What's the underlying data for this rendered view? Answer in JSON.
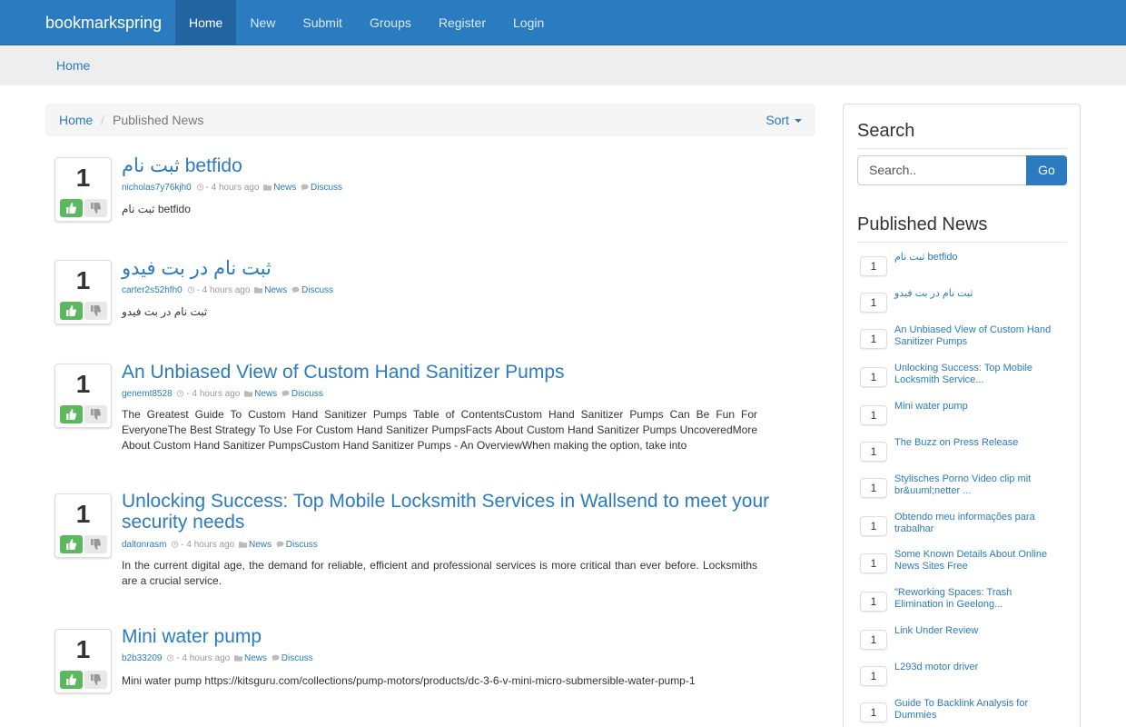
{
  "navbar": {
    "brand": "bookmarkspring",
    "items": [
      {
        "label": "Home",
        "active": true
      },
      {
        "label": "New"
      },
      {
        "label": "Submit"
      },
      {
        "label": "Groups"
      },
      {
        "label": "Register"
      },
      {
        "label": "Login"
      }
    ]
  },
  "jumbotron": {
    "label": "Home"
  },
  "breadcrumb": {
    "home": "Home",
    "current": "Published News",
    "sort_label": "Sort"
  },
  "posts": [
    {
      "votes": "1",
      "title": "ثبت نام betfido",
      "author": "nicholas7y76kjh0",
      "time": "- 4 hours ago",
      "category": "News",
      "discuss": "Discuss",
      "excerpt": "ثبت نام betfido"
    },
    {
      "votes": "1",
      "title": "ثبت نام در بت فیدو",
      "author": "carter2s52hfh0",
      "time": "- 4 hours ago",
      "category": "News",
      "discuss": "Discuss",
      "excerpt": "ثبت نام در بت فیدو"
    },
    {
      "votes": "1",
      "title": "An Unbiased View of Custom Hand Sanitizer Pumps",
      "author": "genemt8528",
      "time": "- 4 hours ago",
      "category": "News",
      "discuss": "Discuss",
      "excerpt": "The Greatest Guide To Custom Hand Sanitizer Pumps Table of ContentsCustom Hand Sanitizer Pumps Can Be Fun For EveryoneThe Best Strategy To Use For Custom Hand Sanitizer PumpsFacts About Custom Hand Sanitizer Pumps UncoveredMore About Custom Hand Sanitizer PumpsCustom Hand Sanitizer Pumps - An OverviewWhen making the option, take into"
    },
    {
      "votes": "1",
      "title": "Unlocking Success: Top Mobile Locksmith Services in Wallsend to meet your security needs",
      "author": "daltonrasm",
      "time": "- 4 hours ago",
      "category": "News",
      "discuss": "Discuss",
      "excerpt": "In the current digital age, the demand for reliable, efficient and professional services is more critical than ever before. Locksmiths are a crucial service."
    },
    {
      "votes": "1",
      "title": "Mini water pump",
      "author": "b2b33209",
      "time": "- 4 hours ago",
      "category": "News",
      "discuss": "Discuss",
      "excerpt": "Mini water pump https://kitsguru.com/collections/pump-motors/products/dc-3-6-v-mini-micro-submersible-water-pump-1"
    }
  ],
  "sidebar": {
    "search_title": "Search",
    "search_placeholder": "Search..",
    "search_button": "Go",
    "published_title": "Published News",
    "items": [
      {
        "count": "1",
        "text": "ثبت نام betfido"
      },
      {
        "count": "1",
        "text": "ثبت نام در بت فیدو"
      },
      {
        "count": "1",
        "text": "An Unbiased View of Custom Hand Sanitizer Pumps"
      },
      {
        "count": "1",
        "text": "Unlocking Success: Top Mobile Locksmith Service..."
      },
      {
        "count": "1",
        "text": "Mini water pump"
      },
      {
        "count": "1",
        "text": "The Buzz on Press Release"
      },
      {
        "count": "1",
        "text": "Stylisches Porno Video clip mit br&uuml;netter ..."
      },
      {
        "count": "1",
        "text": "Obtendo meu informações para trabalhar"
      },
      {
        "count": "1",
        "text": "Some Known Details About Online News Sites Free"
      },
      {
        "count": "1",
        "text": "\"Reworking Spaces: Trash Elimination in Geelong..."
      },
      {
        "count": "1",
        "text": "Link Under Review"
      },
      {
        "count": "1",
        "text": "L293d motor driver"
      },
      {
        "count": "1",
        "text": "Guide To Backlink Analysis for Dummies"
      }
    ]
  },
  "colors": {
    "brand_blue": "#2a7bc0",
    "upvote_green": "#5cb85c"
  },
  "icons": [
    "thumbs-up-icon",
    "thumbs-down-icon",
    "clock-icon",
    "folder-icon",
    "comment-icon",
    "caret-down-icon"
  ]
}
